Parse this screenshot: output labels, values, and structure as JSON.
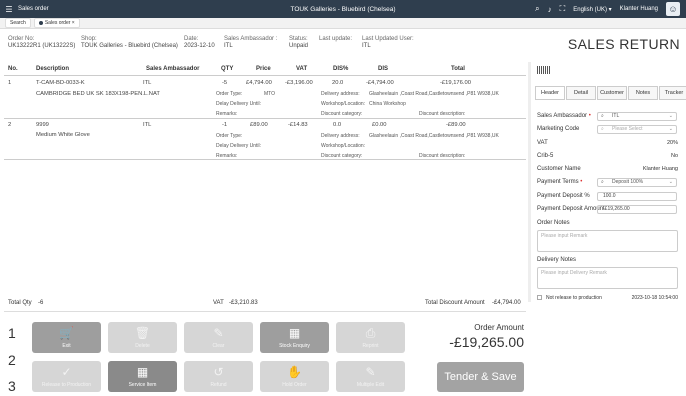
{
  "topbar": {
    "app_title": "Sales order",
    "window_title": "TOUK Galleries - Bluebird (Chelsea)",
    "language": "English (UK)",
    "user": "Klanter Huang"
  },
  "tabs": [
    {
      "label": "Search"
    },
    {
      "label": "Sales order"
    }
  ],
  "header": {
    "order_no_label": "Order No:",
    "order_no": "UK13222R1 (UK13222S)",
    "shop_label": "Shop:",
    "shop": "TOUK Galleries - Bluebird (Chelsea)",
    "date_label": "Date:",
    "date": "2023-12-10",
    "ambassador_label": "Sales Ambassador :",
    "ambassador": "ITL",
    "status_label": "Status:",
    "status": "Unpaid",
    "last_update_label": "Last update:",
    "last_update": "",
    "last_user_label": "Last Updated User:",
    "last_user": "ITL",
    "page_title": "SALES RETURN"
  },
  "table": {
    "columns": [
      "No.",
      "Description",
      "Sales Ambassador",
      "QTY",
      "Price",
      "VAT",
      "DIS%",
      "DIS",
      "Total"
    ],
    "rows": [
      {
        "no": "1",
        "code": "T-CAM-BD-0033-K",
        "desc": "CAMBRIDGE BED UK SK 183X198-PEN.L.NAT",
        "amb": "ITL",
        "qty": "-5",
        "price": "£4,794.00",
        "vat": "-£3,196.00",
        "dis_pct": "20.0",
        "dis": "-£4,794.00",
        "total": "-£19,176.00",
        "order_type_label": "Order Type:",
        "order_type": "MTO",
        "delay_label": "Delay Delivery Until:",
        "delay": "",
        "remarks_label": "Remarks:",
        "remarks": "",
        "delivery_label": "Delivery address:",
        "delivery": "Glasheelauin ,Coast Road,Castletownsend ,P81 W938,UK",
        "workshop_label": "Workshop/Location:",
        "workshop": "China Workshop",
        "discat_label": "Discount category:",
        "discat": "",
        "disdesc_label": "Discount description:",
        "disdesc": ""
      },
      {
        "no": "2",
        "code": "9999",
        "desc": "Medium White Glove",
        "amb": "ITL",
        "qty": "-1",
        "price": "£89.00",
        "vat": "-£14.83",
        "dis_pct": "0.0",
        "dis": "£0.00",
        "total": "-£89.00",
        "order_type_label": "Order Type:",
        "order_type": "",
        "delay_label": "Delay Delivery Until:",
        "delay": "",
        "remarks_label": "Remarks:",
        "remarks": "",
        "delivery_label": "Delivery address:",
        "delivery": "Glasheelauin ,Coast Road,Castletownsend ,P81 W938,UK",
        "workshop_label": "Workshop/Location:",
        "workshop": "",
        "discat_label": "Discount category:",
        "discat": "",
        "disdesc_label": "Discount description:",
        "disdesc": ""
      }
    ]
  },
  "totals": {
    "qty_label": "Total Qty",
    "qty": "-6",
    "vat_label": "VAT",
    "vat": "-£3,210.83",
    "discount_label": "Total Discount Amount",
    "discount": "-£4,794.00"
  },
  "right_panel": {
    "tabs": [
      "Header",
      "Detail",
      "Customer",
      "Notes",
      "Tracker"
    ],
    "sales_amb_label": "Sales Ambassador",
    "sales_amb": "ITL",
    "marketing_label": "Marketing Code",
    "marketing_placeholder": "Please Select",
    "vat_label": "VAT",
    "vat": "20%",
    "crib_label": "Crib-5",
    "crib": "No",
    "customer_label": "Customer Name",
    "customer": "Klanter Huang",
    "terms_label": "Payment Terms",
    "terms": "Deposit 100%",
    "deposit_pct_label": "Payment Deposit %",
    "deposit_pct": "100.0",
    "deposit_amt_label": "Payment Deposit Amount",
    "deposit_amt": "-£19,265.00",
    "order_notes_label": "Order Notes",
    "order_notes_placeholder": "Please input Remark",
    "delivery_notes_label": "Delivery Notes",
    "delivery_notes_placeholder": "Please input Delivery Remark",
    "not_release_label": "Not release to production",
    "timestamp": "2023-10-18 10:54:00"
  },
  "rows_labels": [
    "1",
    "2",
    "3"
  ],
  "buttons": {
    "exit": "Exit",
    "delete": "Delete",
    "clear": "Clear",
    "stock": "Stock Enquiry",
    "reprint": "Reprint",
    "release": "Release to Production",
    "service": "Service Item",
    "refund": "Refund",
    "hold": "Hold Order",
    "multiple_edit": "Multiple Edit"
  },
  "order_amount_label": "Order Amount",
  "order_amount": "-£19,265.00",
  "tender_label": "Tender & Save"
}
